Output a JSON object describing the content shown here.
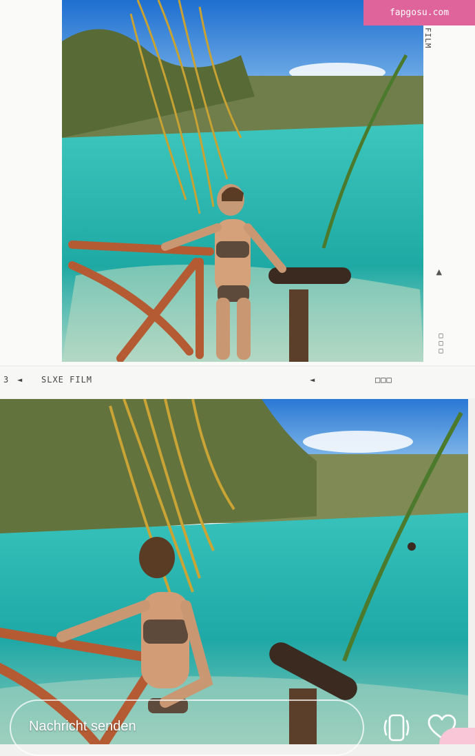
{
  "source_banner": "fapgosu.com",
  "film_strip": {
    "frame_number": "3",
    "frame_arrow": "◄",
    "brand": "SLXE FILM",
    "mid_arrow": "◄",
    "dots": "□□□",
    "vertical_label": "FILM",
    "vertical_arrow": "▲",
    "vertical_dots": "□□□"
  },
  "reply_bar": {
    "placeholder": "Nachricht senden"
  },
  "icons": {
    "sticker": "phone-sticker-icon",
    "like": "heart-icon"
  },
  "colors": {
    "banner": "#e0649c",
    "water": "#2fb8b0",
    "sky": "#2f86d8"
  }
}
